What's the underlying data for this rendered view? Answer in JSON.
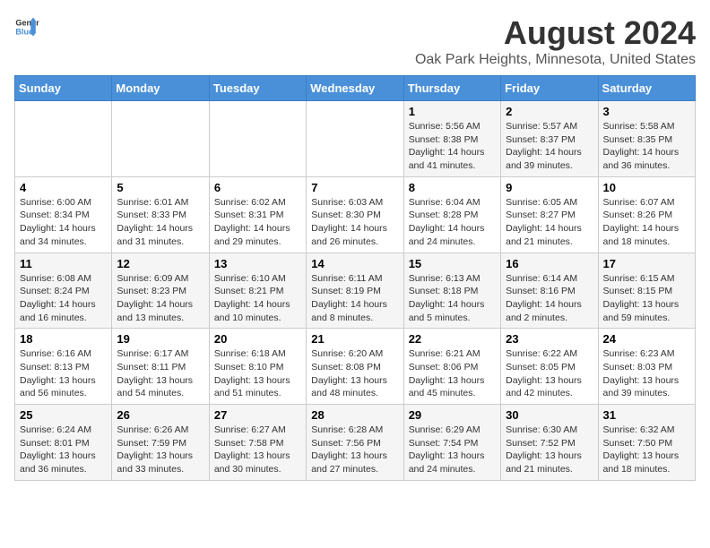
{
  "logo": {
    "general": "General",
    "blue": "Blue"
  },
  "title": "August 2024",
  "subtitle": "Oak Park Heights, Minnesota, United States",
  "days_of_week": [
    "Sunday",
    "Monday",
    "Tuesday",
    "Wednesday",
    "Thursday",
    "Friday",
    "Saturday"
  ],
  "weeks": [
    [
      {
        "day": "",
        "sunrise": "",
        "sunset": "",
        "daylight": ""
      },
      {
        "day": "",
        "sunrise": "",
        "sunset": "",
        "daylight": ""
      },
      {
        "day": "",
        "sunrise": "",
        "sunset": "",
        "daylight": ""
      },
      {
        "day": "",
        "sunrise": "",
        "sunset": "",
        "daylight": ""
      },
      {
        "day": "1",
        "sunrise": "Sunrise: 5:56 AM",
        "sunset": "Sunset: 8:38 PM",
        "daylight": "Daylight: 14 hours and 41 minutes."
      },
      {
        "day": "2",
        "sunrise": "Sunrise: 5:57 AM",
        "sunset": "Sunset: 8:37 PM",
        "daylight": "Daylight: 14 hours and 39 minutes."
      },
      {
        "day": "3",
        "sunrise": "Sunrise: 5:58 AM",
        "sunset": "Sunset: 8:35 PM",
        "daylight": "Daylight: 14 hours and 36 minutes."
      }
    ],
    [
      {
        "day": "4",
        "sunrise": "Sunrise: 6:00 AM",
        "sunset": "Sunset: 8:34 PM",
        "daylight": "Daylight: 14 hours and 34 minutes."
      },
      {
        "day": "5",
        "sunrise": "Sunrise: 6:01 AM",
        "sunset": "Sunset: 8:33 PM",
        "daylight": "Daylight: 14 hours and 31 minutes."
      },
      {
        "day": "6",
        "sunrise": "Sunrise: 6:02 AM",
        "sunset": "Sunset: 8:31 PM",
        "daylight": "Daylight: 14 hours and 29 minutes."
      },
      {
        "day": "7",
        "sunrise": "Sunrise: 6:03 AM",
        "sunset": "Sunset: 8:30 PM",
        "daylight": "Daylight: 14 hours and 26 minutes."
      },
      {
        "day": "8",
        "sunrise": "Sunrise: 6:04 AM",
        "sunset": "Sunset: 8:28 PM",
        "daylight": "Daylight: 14 hours and 24 minutes."
      },
      {
        "day": "9",
        "sunrise": "Sunrise: 6:05 AM",
        "sunset": "Sunset: 8:27 PM",
        "daylight": "Daylight: 14 hours and 21 minutes."
      },
      {
        "day": "10",
        "sunrise": "Sunrise: 6:07 AM",
        "sunset": "Sunset: 8:26 PM",
        "daylight": "Daylight: 14 hours and 18 minutes."
      }
    ],
    [
      {
        "day": "11",
        "sunrise": "Sunrise: 6:08 AM",
        "sunset": "Sunset: 8:24 PM",
        "daylight": "Daylight: 14 hours and 16 minutes."
      },
      {
        "day": "12",
        "sunrise": "Sunrise: 6:09 AM",
        "sunset": "Sunset: 8:23 PM",
        "daylight": "Daylight: 14 hours and 13 minutes."
      },
      {
        "day": "13",
        "sunrise": "Sunrise: 6:10 AM",
        "sunset": "Sunset: 8:21 PM",
        "daylight": "Daylight: 14 hours and 10 minutes."
      },
      {
        "day": "14",
        "sunrise": "Sunrise: 6:11 AM",
        "sunset": "Sunset: 8:19 PM",
        "daylight": "Daylight: 14 hours and 8 minutes."
      },
      {
        "day": "15",
        "sunrise": "Sunrise: 6:13 AM",
        "sunset": "Sunset: 8:18 PM",
        "daylight": "Daylight: 14 hours and 5 minutes."
      },
      {
        "day": "16",
        "sunrise": "Sunrise: 6:14 AM",
        "sunset": "Sunset: 8:16 PM",
        "daylight": "Daylight: 14 hours and 2 minutes."
      },
      {
        "day": "17",
        "sunrise": "Sunrise: 6:15 AM",
        "sunset": "Sunset: 8:15 PM",
        "daylight": "Daylight: 13 hours and 59 minutes."
      }
    ],
    [
      {
        "day": "18",
        "sunrise": "Sunrise: 6:16 AM",
        "sunset": "Sunset: 8:13 PM",
        "daylight": "Daylight: 13 hours and 56 minutes."
      },
      {
        "day": "19",
        "sunrise": "Sunrise: 6:17 AM",
        "sunset": "Sunset: 8:11 PM",
        "daylight": "Daylight: 13 hours and 54 minutes."
      },
      {
        "day": "20",
        "sunrise": "Sunrise: 6:18 AM",
        "sunset": "Sunset: 8:10 PM",
        "daylight": "Daylight: 13 hours and 51 minutes."
      },
      {
        "day": "21",
        "sunrise": "Sunrise: 6:20 AM",
        "sunset": "Sunset: 8:08 PM",
        "daylight": "Daylight: 13 hours and 48 minutes."
      },
      {
        "day": "22",
        "sunrise": "Sunrise: 6:21 AM",
        "sunset": "Sunset: 8:06 PM",
        "daylight": "Daylight: 13 hours and 45 minutes."
      },
      {
        "day": "23",
        "sunrise": "Sunrise: 6:22 AM",
        "sunset": "Sunset: 8:05 PM",
        "daylight": "Daylight: 13 hours and 42 minutes."
      },
      {
        "day": "24",
        "sunrise": "Sunrise: 6:23 AM",
        "sunset": "Sunset: 8:03 PM",
        "daylight": "Daylight: 13 hours and 39 minutes."
      }
    ],
    [
      {
        "day": "25",
        "sunrise": "Sunrise: 6:24 AM",
        "sunset": "Sunset: 8:01 PM",
        "daylight": "Daylight: 13 hours and 36 minutes."
      },
      {
        "day": "26",
        "sunrise": "Sunrise: 6:26 AM",
        "sunset": "Sunset: 7:59 PM",
        "daylight": "Daylight: 13 hours and 33 minutes."
      },
      {
        "day": "27",
        "sunrise": "Sunrise: 6:27 AM",
        "sunset": "Sunset: 7:58 PM",
        "daylight": "Daylight: 13 hours and 30 minutes."
      },
      {
        "day": "28",
        "sunrise": "Sunrise: 6:28 AM",
        "sunset": "Sunset: 7:56 PM",
        "daylight": "Daylight: 13 hours and 27 minutes."
      },
      {
        "day": "29",
        "sunrise": "Sunrise: 6:29 AM",
        "sunset": "Sunset: 7:54 PM",
        "daylight": "Daylight: 13 hours and 24 minutes."
      },
      {
        "day": "30",
        "sunrise": "Sunrise: 6:30 AM",
        "sunset": "Sunset: 7:52 PM",
        "daylight": "Daylight: 13 hours and 21 minutes."
      },
      {
        "day": "31",
        "sunrise": "Sunrise: 6:32 AM",
        "sunset": "Sunset: 7:50 PM",
        "daylight": "Daylight: 13 hours and 18 minutes."
      }
    ]
  ]
}
